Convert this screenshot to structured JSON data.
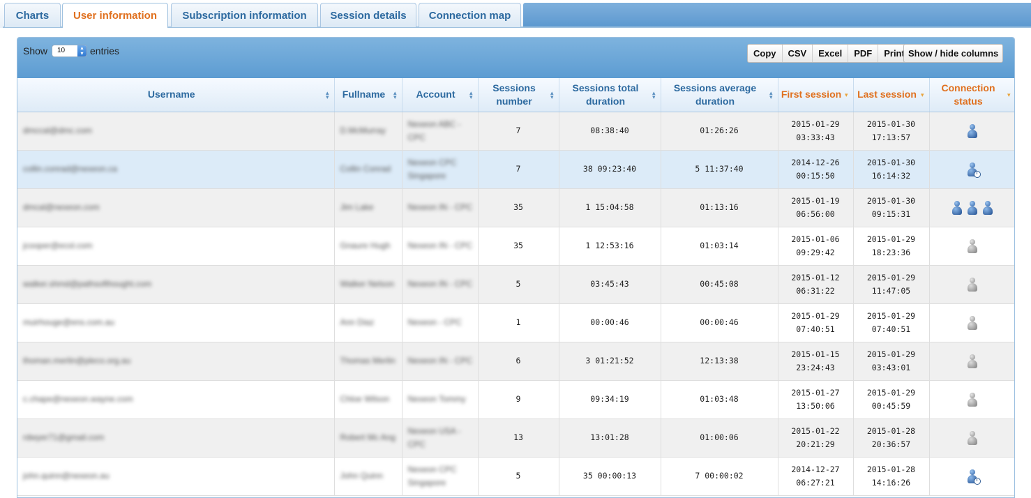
{
  "tabs": [
    {
      "label": "Charts",
      "active": false
    },
    {
      "label": "User information",
      "active": true
    },
    {
      "label": "Subscription information",
      "active": false
    },
    {
      "label": "Session details",
      "active": false
    },
    {
      "label": "Connection map",
      "active": false
    }
  ],
  "length_menu": {
    "show_label": "Show",
    "value": "10",
    "entries_label": "entries"
  },
  "export_buttons": [
    "Copy",
    "CSV",
    "Excel",
    "PDF",
    "Print"
  ],
  "columns_button": "Show / hide columns",
  "columns": [
    {
      "label": "Username",
      "sorted": false
    },
    {
      "label": "Fullname",
      "sorted": false
    },
    {
      "label": "Account",
      "sorted": false
    },
    {
      "label": "Sessions number",
      "sorted": false
    },
    {
      "label": "Sessions total duration",
      "sorted": false
    },
    {
      "label": "Sessions average duration",
      "sorted": false
    },
    {
      "label": "First session",
      "sorted": true
    },
    {
      "label": "Last session",
      "sorted": true
    },
    {
      "label": "Connection status",
      "sorted": true
    }
  ],
  "status_icons": {
    "online": "person-online-icon",
    "idle": "person-idle-icon",
    "offline": "person-offline-icon"
  },
  "rows": [
    {
      "username": "dmccal@dmc.com",
      "fullname": "D.McMurray",
      "account": "Nexeon ABC - CPC",
      "sessions": "7",
      "total": "08:38:40",
      "avg": "01:26:26",
      "first": [
        "2015-01-29",
        "03:33:43"
      ],
      "last": [
        "2015-01-30",
        "17:13:57"
      ],
      "status": "online",
      "count": 1
    },
    {
      "username": "collin.conrad@nexeon.ca",
      "fullname": "Collin Conrad",
      "account": "Nexeon CPC Singapore",
      "sessions": "7",
      "total": "38 09:23:40",
      "avg": "5 11:37:40",
      "first": [
        "2014-12-26",
        "00:15:50"
      ],
      "last": [
        "2015-01-30",
        "16:14:32"
      ],
      "status": "idle",
      "count": 1
    },
    {
      "username": "dmcal@nexeon.com",
      "fullname": "Jim Lake",
      "account": "Nexeon IN - CPC",
      "sessions": "35",
      "total": "1 15:04:58",
      "avg": "01:13:16",
      "first": [
        "2015-01-19",
        "06:56:00"
      ],
      "last": [
        "2015-01-30",
        "09:15:31"
      ],
      "status": "online",
      "count": 3
    },
    {
      "username": "jcooper@ecol.com",
      "fullname": "Gnaure Hugh",
      "account": "Nexeon IN - CPC",
      "sessions": "35",
      "total": "1 12:53:16",
      "avg": "01:03:14",
      "first": [
        "2015-01-06",
        "09:29:42"
      ],
      "last": [
        "2015-01-29",
        "18:23:36"
      ],
      "status": "offline",
      "count": 1
    },
    {
      "username": "walker.shmd@pathsofthought.com",
      "fullname": "Walker Nelson",
      "account": "Nexeon IN - CPC",
      "sessions": "5",
      "total": "03:45:43",
      "avg": "00:45:08",
      "first": [
        "2015-01-12",
        "06:31:22"
      ],
      "last": [
        "2015-01-29",
        "11:47:05"
      ],
      "status": "offline",
      "count": 1
    },
    {
      "username": "muirhouge@ens.com.au",
      "fullname": "Ann Diaz",
      "account": "Nexeon - CPC",
      "sessions": "1",
      "total": "00:00:46",
      "avg": "00:00:46",
      "first": [
        "2015-01-29",
        "07:40:51"
      ],
      "last": [
        "2015-01-29",
        "07:40:51"
      ],
      "status": "offline",
      "count": 1
    },
    {
      "username": "thoman.merlin@pleco.org.au",
      "fullname": "Thomas Merlin",
      "account": "Nexeon IN - CPC",
      "sessions": "6",
      "total": "3 01:21:52",
      "avg": "12:13:38",
      "first": [
        "2015-01-15",
        "23:24:43"
      ],
      "last": [
        "2015-01-29",
        "03:43:01"
      ],
      "status": "offline",
      "count": 1
    },
    {
      "username": "c.chape@nexeon.wayne.com",
      "fullname": "Chloe Wilson",
      "account": "Nexeon Tommy",
      "sessions": "9",
      "total": "09:34:19",
      "avg": "01:03:48",
      "first": [
        "2015-01-27",
        "13:50:06"
      ],
      "last": [
        "2015-01-29",
        "00:45:59"
      ],
      "status": "offline",
      "count": 1
    },
    {
      "username": "rdwyer71@gmail.com",
      "fullname": "Robert Mc Ang",
      "account": "Nexeon USA - CPC",
      "sessions": "13",
      "total": "13:01:28",
      "avg": "01:00:06",
      "first": [
        "2015-01-22",
        "20:21:29"
      ],
      "last": [
        "2015-01-28",
        "20:36:57"
      ],
      "status": "offline",
      "count": 1
    },
    {
      "username": "john.quinn@nexeon.au",
      "fullname": "John Quinn",
      "account": "Nexeon CPC Singapore",
      "sessions": "5",
      "total": "35 00:00:13",
      "avg": "7 00:00:02",
      "first": [
        "2014-12-27",
        "06:27:21"
      ],
      "last": [
        "2015-01-28",
        "14:16:26"
      ],
      "status": "idle",
      "count": 1
    }
  ]
}
